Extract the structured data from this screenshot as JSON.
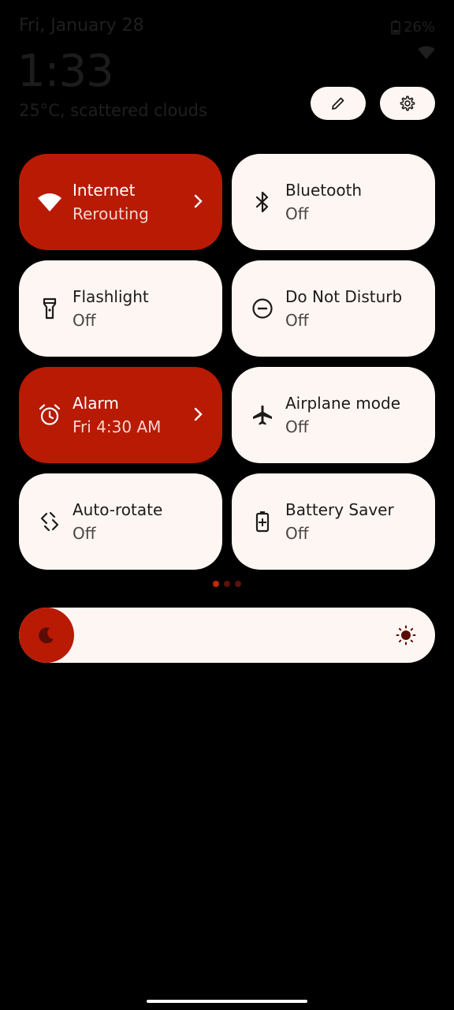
{
  "status_bar": {
    "date": "Fri, January 28",
    "battery": "26%",
    "time": "1:33",
    "weather": "25°C, scattered clouds"
  },
  "header_buttons": [
    {
      "name": "edit-button",
      "icon": "pencil-icon"
    },
    {
      "name": "settings-button",
      "icon": "gear-icon"
    }
  ],
  "tiles": [
    {
      "label": "Internet",
      "sub": "Rerouting",
      "icon": "wifi-icon",
      "active": true,
      "chevron": true
    },
    {
      "label": "Bluetooth",
      "sub": "Off",
      "icon": "bluetooth-icon",
      "active": false
    },
    {
      "label": "Flashlight",
      "sub": "Off",
      "icon": "flashlight-icon",
      "active": false
    },
    {
      "label": "Do Not Disturb",
      "sub": "Off",
      "icon": "do-not-disturb-icon",
      "active": false
    },
    {
      "label": "Alarm",
      "sub": "Fri 4:30 AM",
      "icon": "alarm-icon",
      "active": true,
      "chevron": true
    },
    {
      "label": "Airplane mode",
      "sub": "Off",
      "icon": "airplane-icon",
      "active": false
    },
    {
      "label": "Auto-rotate",
      "sub": "Off",
      "icon": "auto-rotate-icon",
      "active": false
    },
    {
      "label": "Battery Saver",
      "sub": "Off",
      "icon": "battery-saver-icon",
      "active": false
    }
  ],
  "pager": {
    "pages": 3,
    "current": 1
  },
  "brightness": {
    "level": 0.0
  },
  "colors": {
    "accent": "#b81a04",
    "tile_bg": "#fdf6f3",
    "background": "#000000"
  }
}
